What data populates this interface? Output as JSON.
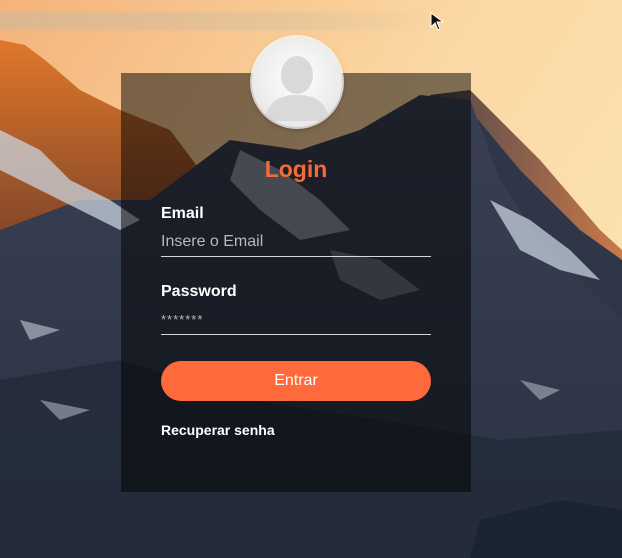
{
  "login": {
    "title": "Login",
    "email_label": "Email",
    "email_placeholder": "Insere o Email",
    "email_value": "",
    "password_label": "Password",
    "password_placeholder": "*******",
    "password_value": "",
    "submit_label": "Entrar",
    "recover_label": "Recuperar senha"
  },
  "icons": {
    "avatar": "user-silhouette-icon",
    "cursor": "mouse-pointer-icon"
  },
  "colors": {
    "accent": "#fe6a3b",
    "title": "#f26b3a",
    "card_overlay": "rgba(0,0,0,0.5)"
  }
}
